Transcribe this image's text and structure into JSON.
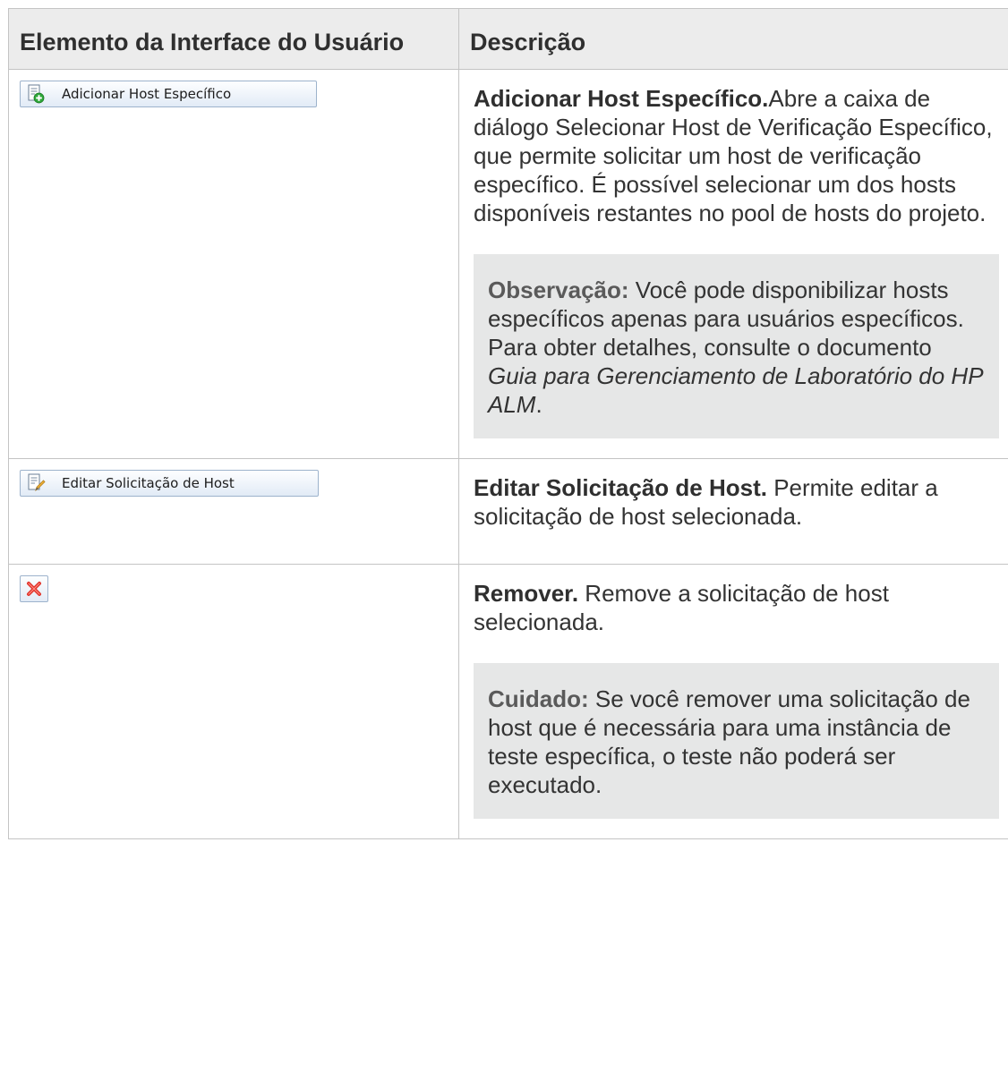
{
  "table": {
    "headers": [
      "Elemento da Interface do Usuário",
      "Descrição"
    ],
    "rows": [
      {
        "button_label": "Adicionar Host Específico",
        "icon": "add-specific-host-icon",
        "title": "Adicionar Host Específico.",
        "text": "Abre a caixa de diálogo Selecionar Host de Verificação Específico, que permite solicitar um host de verificação específico. É possível selecionar um dos hosts disponíveis restantes no pool de hosts do projeto.",
        "note": {
          "label": "Observação:",
          "text": " Você pode disponibilizar hosts específicos apenas para usuários específicos. Para obter detalhes, consulte o documento ",
          "doc_title": "Guia para Gerenciamento de Laboratório do HP ALM",
          "end": "."
        }
      },
      {
        "button_label": "Editar Solicitação de Host",
        "icon": "edit-host-request-icon",
        "title": "Editar Solicitação de Host.",
        "text": " Permite editar a solicitação de host selecionada."
      },
      {
        "icon": "remove-icon",
        "title": "Remover.",
        "text": " Remove a solicitação de host selecionada.",
        "note": {
          "label": "Cuidado:",
          "text": " Se você remover uma solicitação de host que é necessária para uma instância de teste específica, o teste não poderá ser executado."
        }
      }
    ]
  },
  "colors": {
    "header_bg": "#ececec",
    "note_bg": "#e6e7e7",
    "border": "#c4c4c4",
    "button_border": "#9db3cc",
    "remove_red": "#e0342b"
  }
}
